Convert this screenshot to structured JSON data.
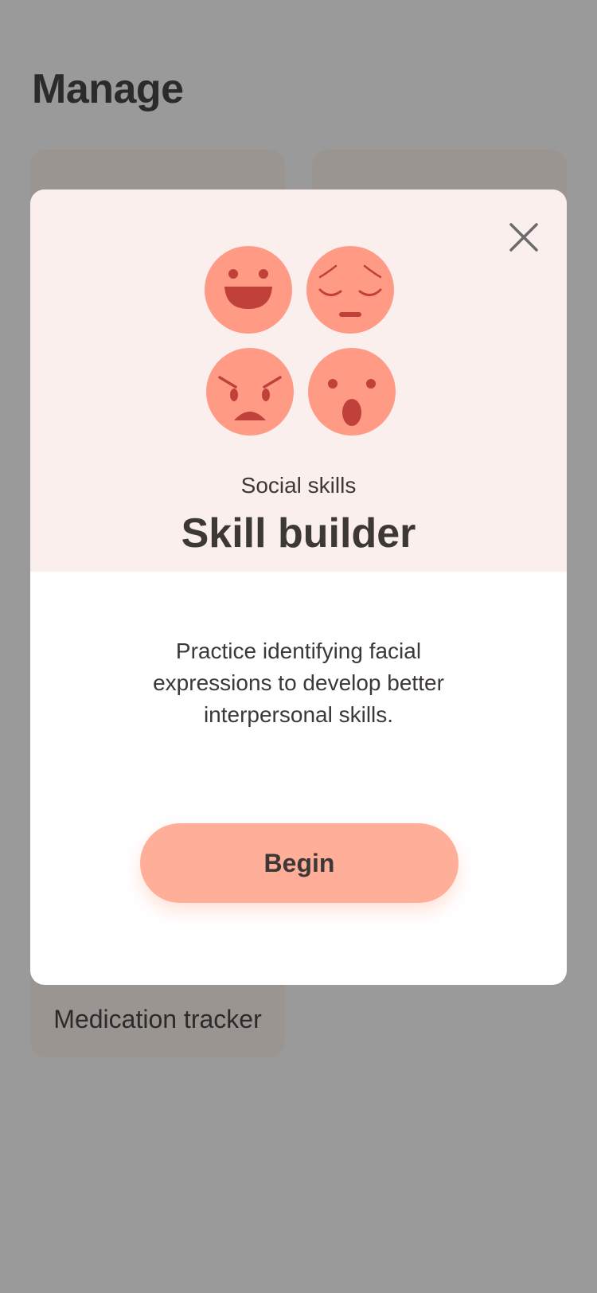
{
  "page": {
    "title": "Manage"
  },
  "background_cards": [
    {
      "label": ""
    },
    {
      "label": ""
    },
    {
      "label": "Medication tracker"
    }
  ],
  "modal": {
    "subtitle": "Social skills",
    "title": "Skill builder",
    "description": "Practice identifying facial expressions to develop better interpersonal skills.",
    "begin_label": "Begin",
    "close_icon": "close-icon",
    "emoji_icons": [
      "happy-face-icon",
      "sad-face-icon",
      "angry-face-icon",
      "surprised-face-icon"
    ]
  },
  "colors": {
    "overlay_background": "#9a9a9a",
    "modal_header": "#faefed",
    "emoji_face": "#ff9b85",
    "emoji_feature": "#c0403a",
    "button": "#ffae99",
    "text": "#3c3836"
  }
}
